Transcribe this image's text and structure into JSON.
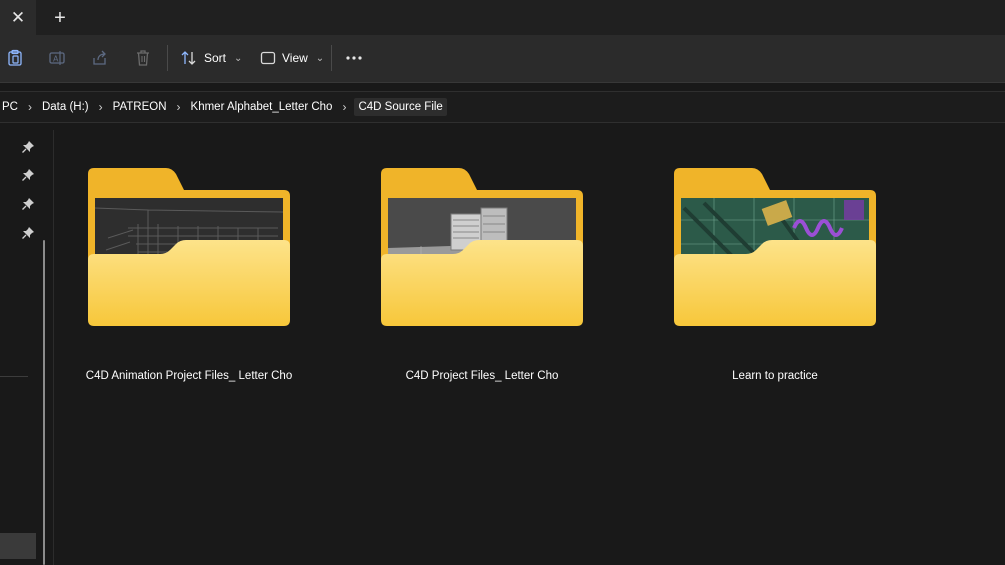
{
  "tabs": {
    "close_icon": "close-icon",
    "new_tab_icon": "plus-icon"
  },
  "toolbar": {
    "sort_label": "Sort",
    "view_label": "View",
    "icons": [
      "paste-icon",
      "rename-icon",
      "share-icon",
      "delete-icon",
      "sort-icon",
      "view-icon",
      "more-icon"
    ]
  },
  "breadcrumb": [
    "PC",
    "Data (H:)",
    "PATREON",
    "Khmer Alphabet_Letter Cho",
    "C4D Source File"
  ],
  "folders": [
    {
      "name": "C4D Animation Project Files_ Letter Cho"
    },
    {
      "name": "C4D Project Files_ Letter Cho"
    },
    {
      "name": "Learn to practice"
    }
  ],
  "colors": {
    "background": "#191919",
    "toolbar": "#2b2b2b",
    "folder_back": "#f0b429",
    "folder_front": "#fbd54a"
  }
}
